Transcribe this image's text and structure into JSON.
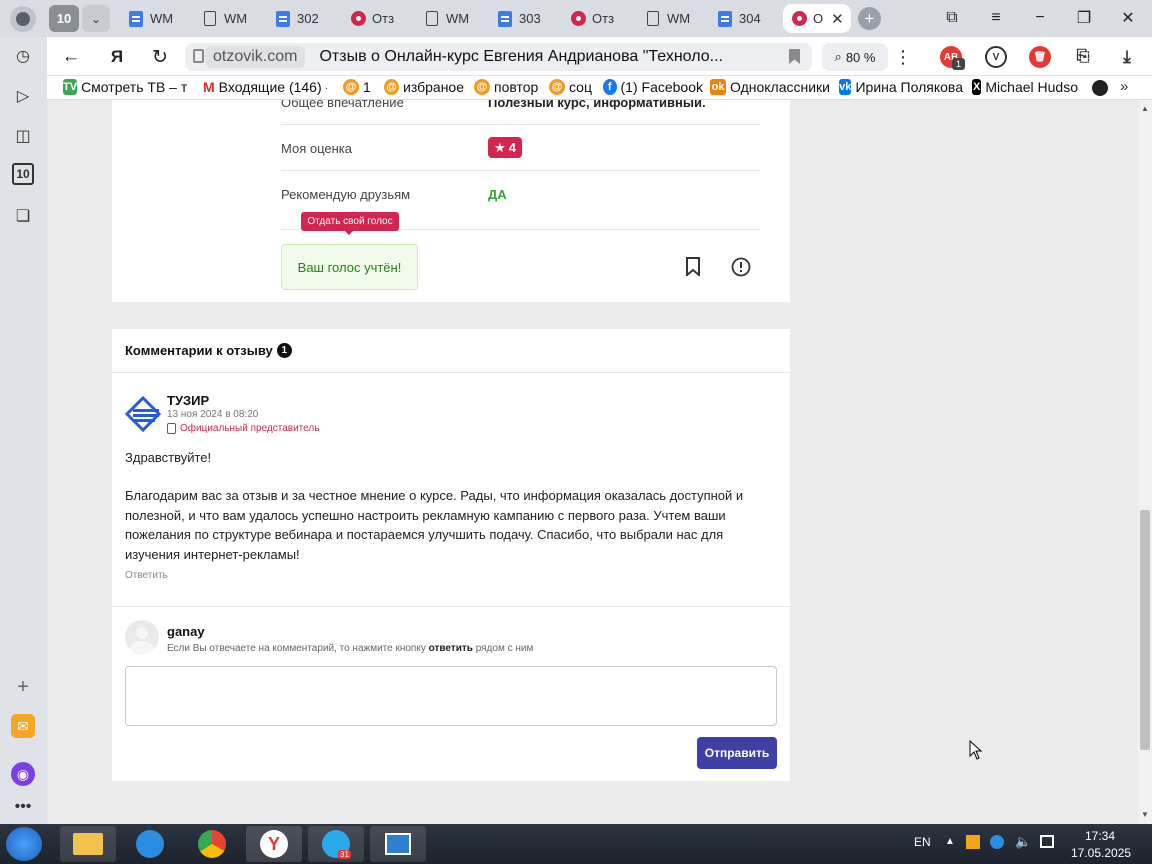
{
  "browser": {
    "tab_counter": "10",
    "tabs": [
      {
        "label": "WM",
        "icon": "doc-blue"
      },
      {
        "label": "WM",
        "icon": "doc-outline"
      },
      {
        "label": "302",
        "icon": "doc-blue"
      },
      {
        "label": "Отз",
        "icon": "otzovik"
      },
      {
        "label": "WM",
        "icon": "doc-outline"
      },
      {
        "label": "303",
        "icon": "doc-blue"
      },
      {
        "label": "Отз",
        "icon": "otzovik"
      },
      {
        "label": "WM",
        "icon": "doc-outline"
      },
      {
        "label": "304",
        "icon": "doc-blue"
      },
      {
        "label": "О",
        "icon": "otzovik"
      }
    ],
    "domain": "otzovik.com",
    "page_title": "Отзыв о Онлайн-курс Евгения Андрианова \"Техноло...",
    "zoom": "80 %",
    "extension_badge": "1",
    "bookmarks": [
      {
        "label": "Смотреть ТВ – те",
        "icon": "tv-icon",
        "color": "#3aa757"
      },
      {
        "label": "Входящие (146) -",
        "icon": "gmail-icon",
        "color": "#d93025"
      },
      {
        "label": "1",
        "icon": "wow-icon",
        "color": "#f29c1f"
      },
      {
        "label": "избраное",
        "icon": "wow-icon",
        "color": "#f29c1f"
      },
      {
        "label": "повтор",
        "icon": "wow-icon",
        "color": "#f29c1f"
      },
      {
        "label": "соц",
        "icon": "wow-icon",
        "color": "#f29c1f"
      },
      {
        "label": "(1) Facebook",
        "icon": "facebook-icon",
        "color": "#1877f2"
      },
      {
        "label": "Одноклассники",
        "icon": "ok-icon",
        "color": "#ee8208"
      },
      {
        "label": "Ирина Полякова",
        "icon": "vk-icon",
        "color": "#0077ff"
      },
      {
        "label": "Michael Hudso",
        "icon": "x-icon",
        "color": "#000000"
      }
    ]
  },
  "review": {
    "impression_label": "Общее впечатление",
    "impression_value": "Полезный курс, информативный.",
    "rating_label": "Моя оценка",
    "rating_value": "4",
    "recommend_label": "Рекомендую друзьям",
    "recommend_value": "ДА",
    "vote_tooltip": "Отдать свой голос",
    "vote_done": "Ваш голос учтён!"
  },
  "comments": {
    "title": "Комментарии к отзыву",
    "count": "1",
    "items": [
      {
        "author": "ТУЗИР",
        "date": "13 ноя 2024 в 08:20",
        "role": "Официальный представитель",
        "greeting": "Здравствуйте!",
        "text": "Благодарим вас за отзыв и за честное мнение о курсе. Рады, что информация оказалась доступной и полезной, и что вам удалось успешно настроить рекламную кампанию с первого раза. Учтем ваши пожелания по структуре вебинара и постараемся улучшить подачу. Спасибо, что выбрали нас для изучения интернет-рекламы!",
        "reply_label": "Ответить"
      }
    ],
    "reply_form": {
      "username": "ganay",
      "hint_before": "Если Вы отвечаете на комментарий, то нажмите кнопку",
      "hint_bold": "ответить",
      "hint_after": "рядом с ним",
      "textarea_value": "",
      "submit_label": "Отправить"
    }
  },
  "taskbar": {
    "language": "EN",
    "time": "17:34",
    "date": "17.05.2025",
    "telegram_badge": "31"
  },
  "colors": {
    "accent": "#d3264f",
    "submit": "#3f3fa6",
    "recommend": "#3aa03a",
    "vote_bg": "#f0fbe9"
  }
}
